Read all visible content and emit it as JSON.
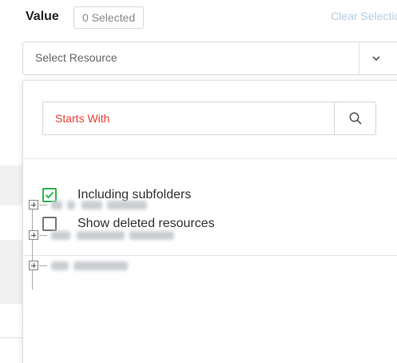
{
  "filter": {
    "label": "Value",
    "selected_count_text": "0 Selected",
    "clear_label": "Clear Selection",
    "select_placeholder": "Select Resource"
  },
  "dropdown": {
    "search": {
      "placeholder": "Starts With"
    },
    "options": [
      {
        "label": "Including subfolders",
        "checked": true
      },
      {
        "label": "Show deleted resources",
        "checked": false
      }
    ],
    "tree_item_count_visible": 3
  },
  "colors": {
    "accent_green": "#2db34a",
    "placeholder_red": "#e8423b",
    "link_blue": "#b7cde3"
  },
  "icons": [
    "chevron-down-icon",
    "search-icon",
    "check-icon",
    "expand-icon"
  ]
}
